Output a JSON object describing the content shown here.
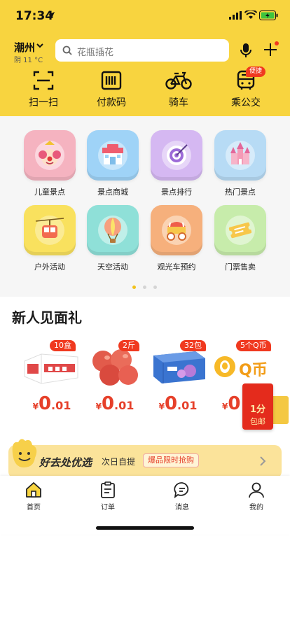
{
  "status": {
    "time": "17:34"
  },
  "header": {
    "city": "潮州",
    "weather": "阴 11 °C",
    "search_placeholder": "花瓶插花",
    "icons": [
      "chevron-down-icon",
      "search-icon",
      "microphone-icon",
      "plus-icon"
    ]
  },
  "quick_actions": [
    {
      "label": "扫一扫",
      "icon": "scan-icon"
    },
    {
      "label": "付款码",
      "icon": "barcode-icon"
    },
    {
      "label": "骑车",
      "icon": "bicycle-icon"
    },
    {
      "label": "乘公交",
      "icon": "bus-icon",
      "badge": "便捷"
    }
  ],
  "categories": [
    {
      "label": "儿童景点",
      "color": "#f5b3c0",
      "icon": "clown-icon"
    },
    {
      "label": "景点商城",
      "color": "#9fd3f7",
      "icon": "shop-icon"
    },
    {
      "label": "景点排行",
      "color": "#d5b8f2",
      "icon": "target-icon"
    },
    {
      "label": "热门景点",
      "color": "#b7dbf5",
      "icon": "castle-icon"
    },
    {
      "label": "户外活动",
      "color": "#f9e15e",
      "icon": "cable-car-icon"
    },
    {
      "label": "天空活动",
      "color": "#8fe0d8",
      "icon": "hot-air-balloon-icon"
    },
    {
      "label": "观光车预约",
      "color": "#f6b07c",
      "icon": "carriage-icon"
    },
    {
      "label": "门票售卖",
      "color": "#c7ecab",
      "icon": "ticket-icon"
    }
  ],
  "carousel": {
    "pages": 3,
    "active": 0
  },
  "new_user": {
    "title": "新人见面礼",
    "products": [
      {
        "badge": "10盒",
        "currency": "¥",
        "price_int": "0",
        "price_dec": ".01",
        "image": "drink-box-image"
      },
      {
        "badge": "2斤",
        "currency": "¥",
        "price_int": "0",
        "price_dec": ".01",
        "image": "apples-image"
      },
      {
        "badge": "32包",
        "currency": "¥",
        "price_int": "0",
        "price_dec": ".01",
        "image": "tissue-pack-image"
      },
      {
        "badge": "5个Q币",
        "currency": "¥",
        "price_int": "0",
        "price_dec": "",
        "image": "qq-coin-image",
        "qtext": "Q币"
      }
    ],
    "red_packet": {
      "line1": "1分",
      "line2": "包邮"
    }
  },
  "banner": {
    "title": "好去处优选",
    "subtitle": "次日自提",
    "tag": "爆品限时抢购"
  },
  "tabs": [
    {
      "label": "首页",
      "icon": "home-icon",
      "active": true
    },
    {
      "label": "订单",
      "icon": "order-icon"
    },
    {
      "label": "消息",
      "icon": "message-icon"
    },
    {
      "label": "我的",
      "icon": "profile-icon"
    }
  ],
  "colors": {
    "brand_yellow": "#f8d43f",
    "accent_red": "#f0391f",
    "price_red": "#e6402a"
  }
}
